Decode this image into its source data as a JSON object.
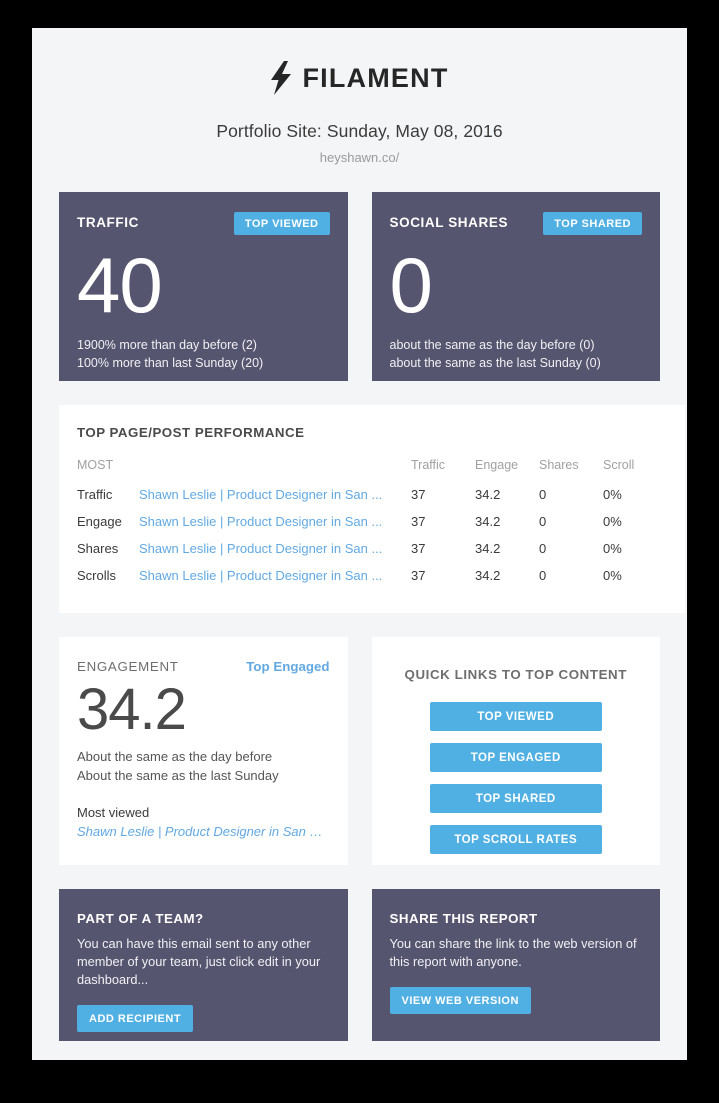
{
  "brand": {
    "logo_icon": "lightning-bolt-icon",
    "name": "FILAMENT"
  },
  "header": {
    "report_title": "Portfolio Site: Sunday, May 08, 2016",
    "site_url": "heyshawn.co/"
  },
  "colors": {
    "accent_blue": "#51b0e3",
    "dark_panel": "#565570",
    "page_background": "#f4f5f7",
    "link_blue": "#62a9e2"
  },
  "traffic": {
    "label": "TRAFFIC",
    "button_label": "TOP VIEWED",
    "value": "40",
    "compare_day": "1900% more than day before (2)",
    "compare_week": "100% more than last Sunday (20)"
  },
  "social_shares": {
    "label": "SOCIAL SHARES",
    "button_label": "TOP SHARED",
    "value": "0",
    "compare_day": "about the same as the day before (0)",
    "compare_week": "about the same as the last Sunday (0)"
  },
  "performance": {
    "title": "TOP PAGE/POST PERFORMANCE",
    "columns": [
      "MOST",
      "",
      "Traffic",
      "Engage",
      "Shares",
      "Scroll"
    ],
    "rows": [
      {
        "most": "Traffic",
        "page": "Shawn Leslie | Product Designer in San ...",
        "traffic": "37",
        "engage": "34.2",
        "shares": "0",
        "scroll": "0%"
      },
      {
        "most": "Engage",
        "page": "Shawn Leslie | Product Designer in San ...",
        "traffic": "37",
        "engage": "34.2",
        "shares": "0",
        "scroll": "0%"
      },
      {
        "most": "Shares",
        "page": "Shawn Leslie | Product Designer in San ...",
        "traffic": "37",
        "engage": "34.2",
        "shares": "0",
        "scroll": "0%"
      },
      {
        "most": "Scrolls",
        "page": "Shawn Leslie | Product Designer in San ...",
        "traffic": "37",
        "engage": "34.2",
        "shares": "0",
        "scroll": "0%"
      }
    ]
  },
  "engagement": {
    "label": "ENGAGEMENT",
    "link_label": "Top Engaged",
    "value": "34.2",
    "compare_day": "About the same as the day before",
    "compare_week": "About the same as the last Sunday",
    "most_viewed_label": "Most viewed",
    "most_viewed_link": "Shawn Leslie | Product Designer in San Die..."
  },
  "quick_links": {
    "title": "QUICK LINKS TO TOP CONTENT",
    "buttons": [
      "TOP VIEWED",
      "TOP ENGAGED",
      "TOP SHARED",
      "TOP SCROLL RATES"
    ]
  },
  "team_promo": {
    "title": "PART OF A TEAM?",
    "body": "You can have this email sent to any other member of your team, just click edit in your dashboard...",
    "button_label": "ADD RECIPIENT"
  },
  "share_promo": {
    "title": "SHARE THIS REPORT",
    "body": "You can share the link to the web version of this report with anyone.",
    "button_label": "VIEW WEB VERSION"
  }
}
